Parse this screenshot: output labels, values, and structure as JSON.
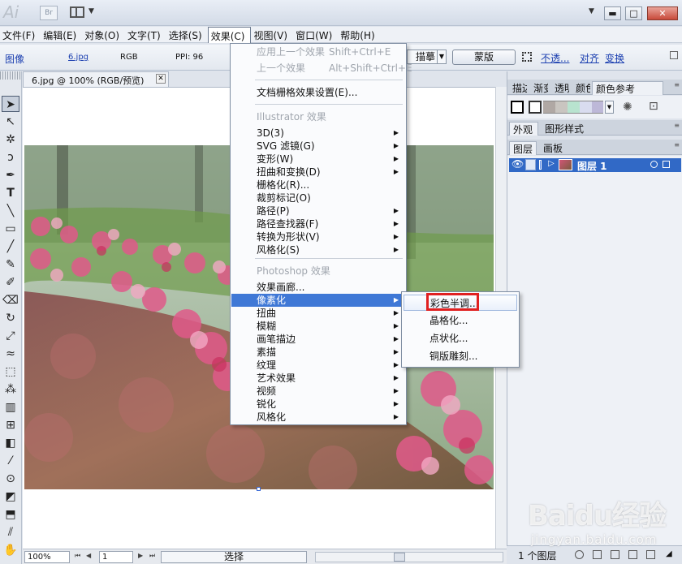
{
  "app": {
    "logo": "Ai",
    "bridge_label": "Br"
  },
  "window_controls": {
    "minimize": "▬",
    "maximize": "□",
    "close": "✕"
  },
  "menubar": {
    "items": [
      {
        "label": "文件(F)"
      },
      {
        "label": "编辑(E)"
      },
      {
        "label": "对象(O)"
      },
      {
        "label": "文字(T)"
      },
      {
        "label": "选择(S)"
      },
      {
        "label": "效果(C)"
      },
      {
        "label": "视图(V)"
      },
      {
        "label": "窗口(W)"
      },
      {
        "label": "帮助(H)"
      }
    ],
    "active": "效果(C)"
  },
  "controlbar": {
    "mode": "图像",
    "file": "6.jpg",
    "color_mode": "RGB",
    "ppi": "PPI: 96",
    "trace_label": "描摹",
    "mask_button": "蒙版",
    "opacity_link": "不透...",
    "align_link": "对齐",
    "transform_link": "变换"
  },
  "document": {
    "tab_title": "6.jpg @ 100% (RGB/预览)",
    "close_glyph": "✕"
  },
  "statusbar": {
    "zoom": "100%",
    "page": "1",
    "tool_status": "选择"
  },
  "effect_menu": {
    "items": [
      {
        "label": "应用上一个效果",
        "shortcut": "Shift+Ctrl+E",
        "disabled": true
      },
      {
        "label": "上一个效果",
        "shortcut": "Alt+Shift+Ctrl+E",
        "disabled": true
      },
      {
        "label": "文档栅格效果设置(E)..."
      },
      {
        "label": "Illustrator 效果",
        "header": true
      },
      {
        "label": "3D(3)",
        "submenu": true
      },
      {
        "label": "SVG 滤镜(G)",
        "submenu": true
      },
      {
        "label": "变形(W)",
        "submenu": true
      },
      {
        "label": "扭曲和变换(D)",
        "submenu": true
      },
      {
        "label": "栅格化(R)..."
      },
      {
        "label": "裁剪标记(O)"
      },
      {
        "label": "路径(P)",
        "submenu": true
      },
      {
        "label": "路径查找器(F)",
        "submenu": true
      },
      {
        "label": "转换为形状(V)",
        "submenu": true
      },
      {
        "label": "风格化(S)",
        "submenu": true
      },
      {
        "label": "Photoshop 效果",
        "header": true
      },
      {
        "label": "效果画廊..."
      },
      {
        "label": "像素化",
        "submenu": true,
        "highlighted": true
      },
      {
        "label": "扭曲",
        "submenu": true
      },
      {
        "label": "模糊",
        "submenu": true
      },
      {
        "label": "画笔描边",
        "submenu": true
      },
      {
        "label": "素描",
        "submenu": true
      },
      {
        "label": "纹理",
        "submenu": true
      },
      {
        "label": "艺术效果",
        "submenu": true
      },
      {
        "label": "视频",
        "submenu": true
      },
      {
        "label": "锐化",
        "submenu": true
      },
      {
        "label": "风格化",
        "submenu": true
      }
    ]
  },
  "pixelate_submenu": {
    "items": [
      {
        "label": "彩色半调...",
        "highlighted": true
      },
      {
        "label": "晶格化..."
      },
      {
        "label": "点状化..."
      },
      {
        "label": "铜版雕刻..."
      }
    ]
  },
  "panels": {
    "group1_tabs": [
      "描边",
      "渐变",
      "透明",
      "颜色",
      "颜色参考"
    ],
    "group1_active": "颜色参考",
    "group2_tabs": [
      "外观",
      "图形样式"
    ],
    "group3_tabs": [
      "图层",
      "画板"
    ],
    "layer": {
      "name": "图层 1"
    },
    "layers_count": "1 个图层"
  },
  "colors": {
    "accent": "#3f78d6",
    "layer_selected": "#3169c6",
    "highlight_box": "#e02020",
    "harmony_swatches": [
      "#b0a8a4",
      "#c9c5c0",
      "#b8e3cf",
      "#d9dcef",
      "#bdb8d8"
    ]
  },
  "watermark": {
    "logo": "Baidu经验",
    "site": "jingyan.baidu.com"
  }
}
